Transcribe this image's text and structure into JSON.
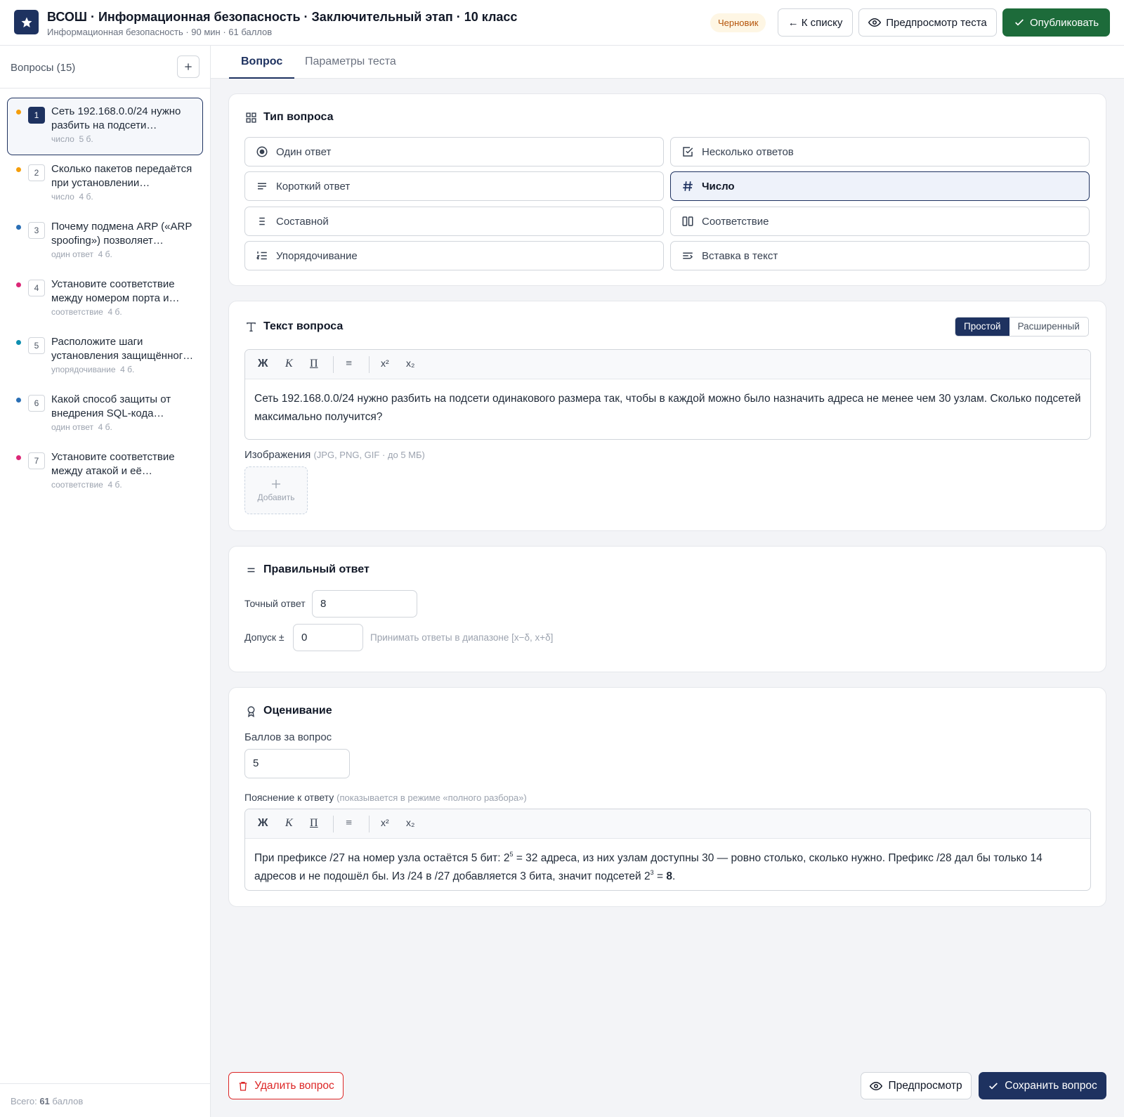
{
  "header": {
    "title": "ВСОШ · Информационная безопасность · Заключительный этап · 10 класс",
    "subtitle": "Информационная безопасность · 90 мин · 61 баллов",
    "status_badge": "Черновик",
    "back_label": "← К списку",
    "preview_test_label": "Предпросмотр теста",
    "publish_label": "Опубликовать"
  },
  "sidebar": {
    "title": "Вопросы (15)",
    "questions": [
      {
        "num": "1",
        "text": "Сеть 192.168.0.0/24 нужно разбить на подсети…",
        "type": "число",
        "points": "5 б.",
        "dot": "#f59e0b"
      },
      {
        "num": "2",
        "text": "Сколько пакетов передаётся при установлении…",
        "type": "число",
        "points": "4 б.",
        "dot": "#f59e0b"
      },
      {
        "num": "3",
        "text": "Почему подмена ARP («ARP spoofing») позволяет…",
        "type": "один ответ",
        "points": "4 б.",
        "dot": "#2a6fb5"
      },
      {
        "num": "4",
        "text": "Установите соответствие между номером порта и…",
        "type": "соответствие",
        "points": "4 б.",
        "dot": "#db2777"
      },
      {
        "num": "5",
        "text": "Расположите шаги установления защищённог…",
        "type": "упорядочивание",
        "points": "4 б.",
        "dot": "#0e8fb0"
      },
      {
        "num": "6",
        "text": "Какой способ защиты от внедрения SQL-кода…",
        "type": "один ответ",
        "points": "4 б.",
        "dot": "#2a6fb5"
      },
      {
        "num": "7",
        "text": "Установите соответствие между атакой и её…",
        "type": "соответствие",
        "points": "4 б.",
        "dot": "#db2777"
      }
    ],
    "total_prefix": "Всего:",
    "total_value": "61",
    "total_suffix": "баллов"
  },
  "tabs": {
    "question": "Вопрос",
    "params": "Параметры теста"
  },
  "question_type": {
    "title": "Тип вопроса",
    "options": [
      {
        "label": "Один ответ",
        "icon": "radio-icon"
      },
      {
        "label": "Несколько ответов",
        "icon": "checkbox-icon"
      },
      {
        "label": "Короткий ответ",
        "icon": "text-lines-icon"
      },
      {
        "label": "Число",
        "icon": "hash-icon"
      },
      {
        "label": "Составной",
        "icon": "list-icon"
      },
      {
        "label": "Соответствие",
        "icon": "columns-icon"
      },
      {
        "label": "Упорядочивание",
        "icon": "ordered-list-icon"
      },
      {
        "label": "Вставка в текст",
        "icon": "insert-text-icon"
      }
    ],
    "selected": "Число"
  },
  "question_text": {
    "title": "Текст вопроса",
    "mode_simple": "Простой",
    "mode_advanced": "Расширенный",
    "toolbar": {
      "bold": "Ж",
      "italic": "К",
      "underline": "П",
      "list": "≡",
      "sup": "x²",
      "sub": "x₂"
    },
    "body": "Сеть 192.168.0.0/24 нужно разбить на подсети одинакового размера так, чтобы в каждой можно было назначить адреса не менее чем 30 узлам. Сколько подсетей максимально получится?",
    "images_label": "Изображения",
    "images_hint": "(JPG, PNG, GIF · до 5 МБ)",
    "add_label": "Добавить"
  },
  "correct_answer": {
    "title": "Правильный ответ",
    "exact_label": "Точный ответ",
    "exact_value": "8",
    "tolerance_label": "Допуск ±",
    "tolerance_value": "0",
    "tolerance_hint": "Принимать ответы в диапазоне [x−δ, x+δ]"
  },
  "grading": {
    "title": "Оценивание",
    "points_label": "Баллов за вопрос",
    "points_value": "5",
    "explanation_label": "Пояснение к ответу",
    "explanation_hint": "(показывается в режиме «полного разбора»)",
    "explanation_part1": "При префиксе /27 на номер узла остаётся 5 бит: 2",
    "explanation_sup1": "5",
    "explanation_part2": " = 32 адреса, из них узлам доступны 30 — ровно столько, сколько нужно. Префикс /28 дал бы только 14 адресов и не подошёл бы. Из /24 в /27 добавляется 3 бита, значит подсетей 2",
    "explanation_sup2": "3",
    "explanation_part3": " = ",
    "explanation_answer": "8",
    "explanation_end": "."
  },
  "footer": {
    "delete_label": "Удалить вопрос",
    "preview_label": "Предпросмотр",
    "save_label": "Сохранить вопрос"
  },
  "colors": {
    "brand": "#1e3260",
    "publish": "#1d6b3a",
    "danger": "#dc2626",
    "badge_bg": "#fef6e4",
    "badge_text": "#b45309"
  }
}
